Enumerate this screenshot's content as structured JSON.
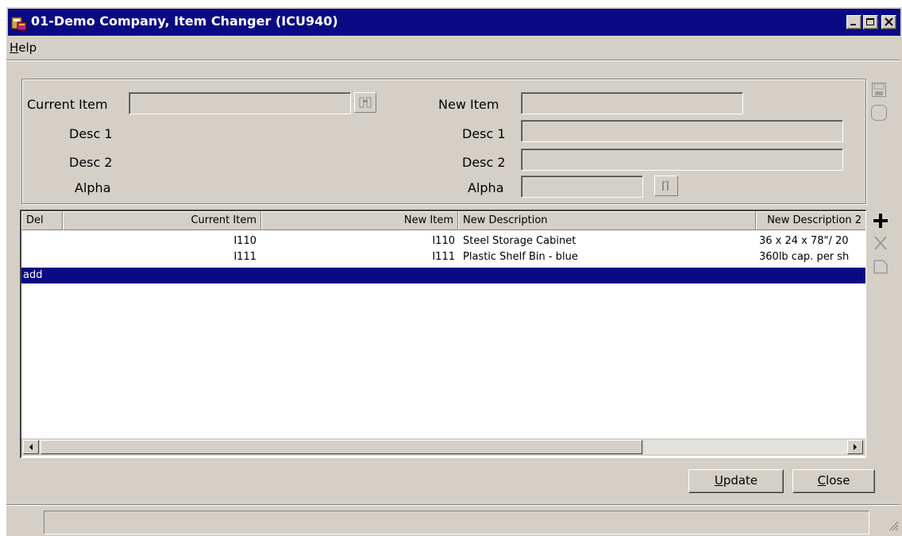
{
  "window": {
    "title": "01-Demo Company, Item Changer (ICU940)"
  },
  "menu": {
    "help_first": "H",
    "help_rest": "elp"
  },
  "form": {
    "current_item_label": "Current Item",
    "current_desc1_label": "Desc 1",
    "current_desc2_label": "Desc 2",
    "current_alpha_label": "Alpha",
    "new_item_label": "New Item",
    "new_desc1_label": "Desc 1",
    "new_desc2_label": "Desc 2",
    "new_alpha_label": "Alpha",
    "current_item_value": "",
    "new_item_value": "",
    "new_desc1_value": "",
    "new_desc2_value": "",
    "new_alpha_value": ""
  },
  "grid": {
    "columns": [
      "Del",
      "Current Item",
      "New Item",
      "New Description",
      "New Description 2"
    ],
    "rows": [
      {
        "del": "",
        "current_item": "I110",
        "new_item": "I110",
        "new_description": "Steel Storage Cabinet",
        "new_description_2": "36 x 24 x 78\"/ 20"
      },
      {
        "del": "",
        "current_item": "I111",
        "new_item": "I111",
        "new_description": "Plastic Shelf Bin - blue",
        "new_description_2": "360lb cap. per sh"
      }
    ],
    "add_row_label": "add"
  },
  "buttons": {
    "update_first": "U",
    "update_rest": "pdate",
    "close_first": "C",
    "close_rest": "lose"
  },
  "colors": {
    "titlebar": "#0a0a84",
    "face": "#d4d0c8",
    "selection": "#0a0a84"
  },
  "icons": [
    "app-icon",
    "minimize-icon",
    "maximize-icon",
    "close-icon",
    "binoculars-icon",
    "lookup-icon",
    "save-icon",
    "refresh-icon",
    "add-row-icon",
    "delete-row-icon",
    "edit-row-icon",
    "scroll-left-icon",
    "scroll-right-icon",
    "resize-grip-icon"
  ]
}
